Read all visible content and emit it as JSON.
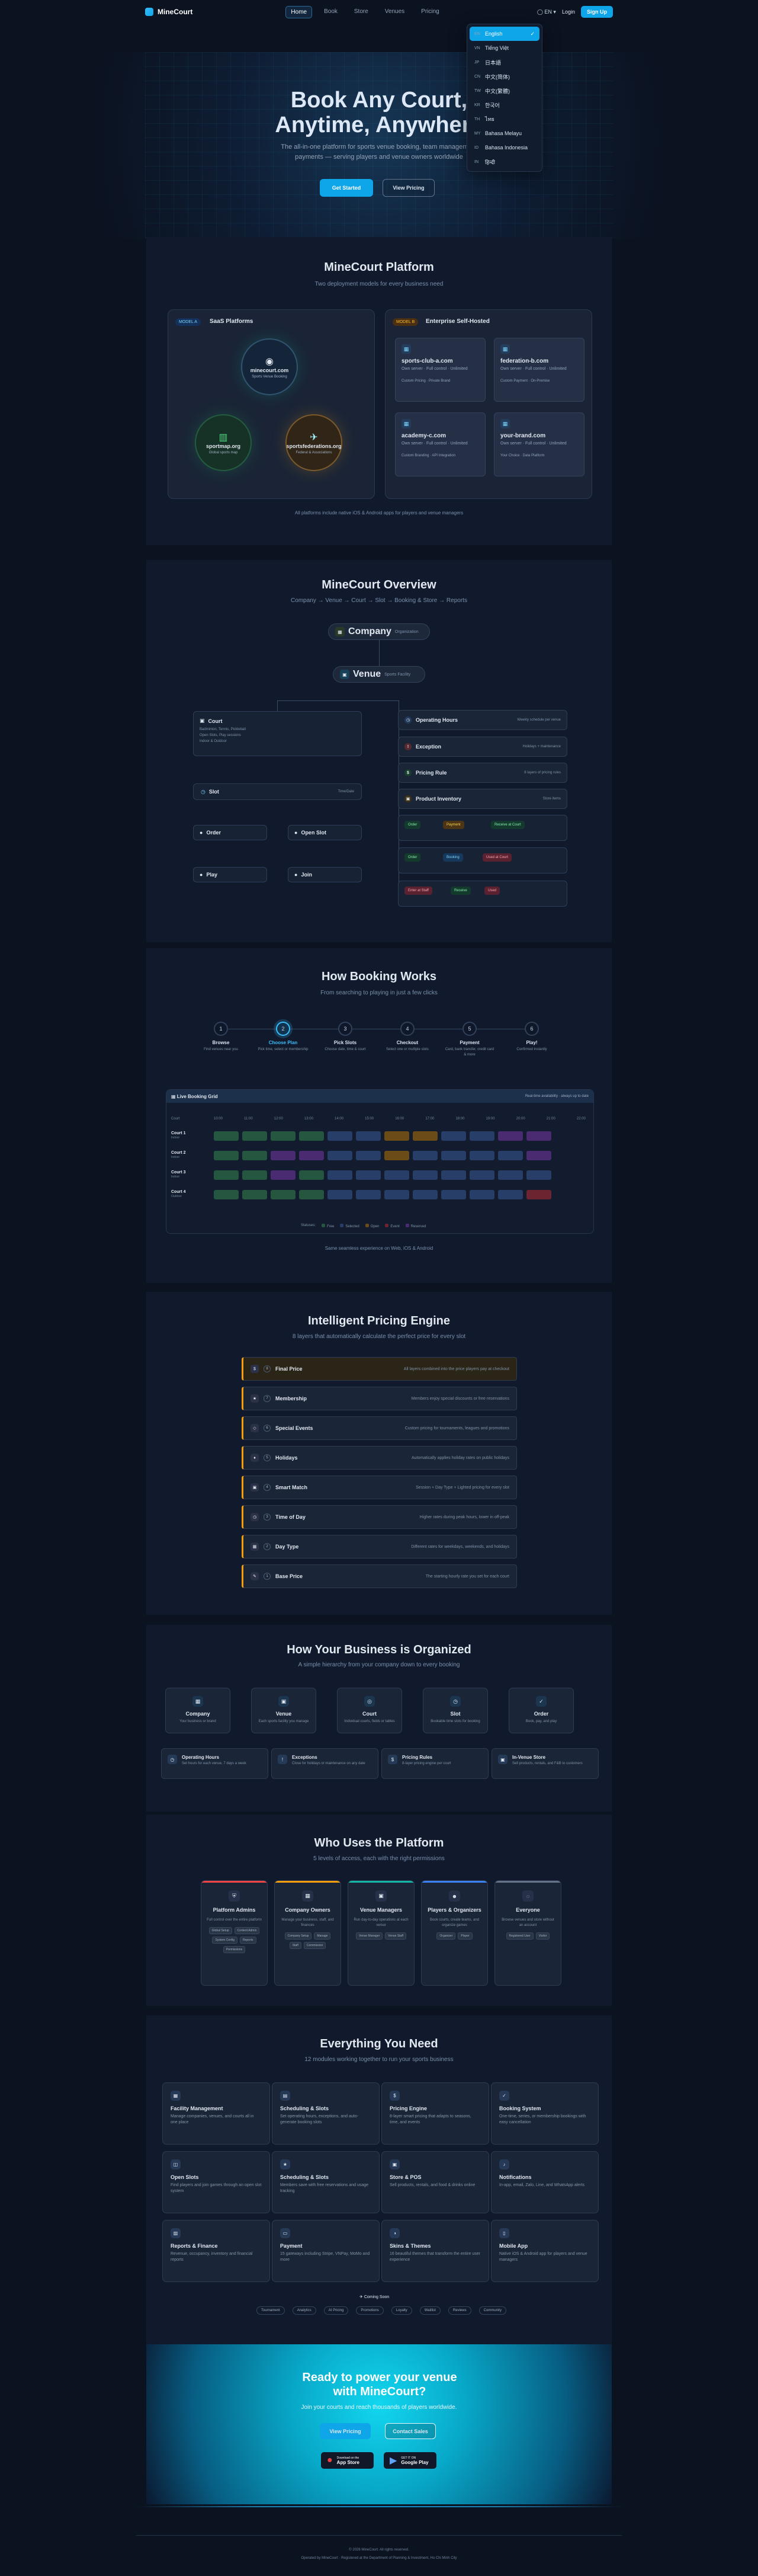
{
  "nav": {
    "brand": "MineCourt",
    "links": [
      "Home",
      "Book",
      "Store",
      "Venues",
      "Pricing"
    ],
    "language": "EN",
    "login": "Login",
    "signup": "Sign Up"
  },
  "languages": [
    {
      "code": "EN",
      "label": "English"
    },
    {
      "code": "VN",
      "label": "Tiếng Việt"
    },
    {
      "code": "JP",
      "label": "日本語"
    },
    {
      "code": "CN",
      "label": "中文(简体)"
    },
    {
      "code": "TW",
      "label": "中文(繁體)"
    },
    {
      "code": "KR",
      "label": "한국어"
    },
    {
      "code": "TH",
      "label": "ไทย"
    },
    {
      "code": "MY",
      "label": "Bahasa Melayu"
    },
    {
      "code": "ID",
      "label": "Bahasa Indonesia"
    },
    {
      "code": "IN",
      "label": "हिन्दी"
    }
  ],
  "hero": {
    "title_line1": "Book Any Court,",
    "title_line2": "Anytime, Anywhere",
    "subtitle_line1": "The all-in-one platform for sports venue booking, team management",
    "subtitle_line2": "payments — serving players and venue owners worldwide",
    "primary": "Get Started",
    "secondary": "View Pricing"
  },
  "platform": {
    "title": "MineCourt Platform",
    "subtitle": "Two deployment models for every business need",
    "saas_tag": "MODEL A",
    "saas_title": "SaaS Platforms",
    "enterprise_tag": "MODEL B",
    "enterprise_title": "Enterprise Self-Hosted",
    "circles": [
      {
        "name": "minecourt.com",
        "desc": "Sports Venue Booking"
      },
      {
        "name": "sportmap.org",
        "desc": "Global sports map"
      },
      {
        "name": "sportsfederations.org",
        "desc": "Federal & Associations"
      }
    ],
    "sites": [
      {
        "name": "sports-club-a.com",
        "desc": "Own server · Full control · Unlimited",
        "foot": "Custom Pricing · Private Brand"
      },
      {
        "name": "federation-b.com",
        "desc": "Own server · Full control · Unlimited",
        "foot": "Custom Payment · On-Premise"
      },
      {
        "name": "academy-c.com",
        "desc": "Own server · Full control · Unlimited",
        "foot": "Custom Branding · API Integration"
      },
      {
        "name": "your-brand.com",
        "desc": "Own server · Full control · Unlimited",
        "foot": "Your Choice · Data Platform"
      }
    ],
    "note": "All platforms include native iOS & Android apps for players and venue managers"
  },
  "overview": {
    "title": "MineCourt Overview",
    "flow": "Company → Venue → Court → Slot → Booking & Store → Reports",
    "company": "Company",
    "company_sub": "Organization",
    "venue": "Venue",
    "venue_sub": "Sports Facility",
    "court": "Court",
    "court_lines": [
      "Badminton, Tennis, Pickleball",
      "Open Slots, Play sessions",
      "Indoor & Outdoor"
    ],
    "slot": "Slot",
    "time_label": "Time/Date",
    "items": [
      "Order",
      "Open Slot",
      "Play",
      "Join"
    ],
    "rules": [
      {
        "name": "Operating Hours",
        "desc": "Weekly schedule per venue"
      },
      {
        "name": "Exception",
        "desc": "Holidays + maintenance"
      },
      {
        "name": "Pricing Rule",
        "desc": "8 layers of pricing rules"
      },
      {
        "name": "Product Inventory",
        "desc": "Store items"
      }
    ],
    "status_row1": [
      "Order",
      "Payment",
      "Receive at Court"
    ],
    "status_row2": [
      "Order",
      "Booking",
      "Used at Court"
    ],
    "status_row3": [
      "Enter at Staff",
      "Receive",
      "Used"
    ]
  },
  "booking": {
    "title": "How Booking Works",
    "subtitle": "From searching to playing in just a few clicks",
    "steps": [
      {
        "n": "1",
        "t": "Browse",
        "d": "Find venues near you"
      },
      {
        "n": "2",
        "t": "Choose Plan",
        "d": "Pick time, select or membership"
      },
      {
        "n": "3",
        "t": "Pick Slots",
        "d": "Choose date, time & court"
      },
      {
        "n": "4",
        "t": "Checkout",
        "d": "Select one or multiple slots"
      },
      {
        "n": "5",
        "t": "Payment",
        "d": "Card, bank transfer, credit card & more"
      },
      {
        "n": "6",
        "t": "Play!",
        "d": "Confirmed instantly"
      }
    ],
    "grid_title": "Live Booking Grid",
    "grid_hint": "Real-time availability · always up to date",
    "court_col": "Court",
    "times": [
      "10:00",
      "11:00",
      "12:00",
      "13:00",
      "14:00",
      "15:00",
      "16:00",
      "17:00",
      "18:00",
      "19:00",
      "20:00",
      "21:00",
      "22:00"
    ],
    "courts": [
      {
        "name": "Court 1",
        "type": "Indoor"
      },
      {
        "name": "Court 2",
        "type": "Indoor"
      },
      {
        "name": "Court 3",
        "type": "Indoor"
      },
      {
        "name": "Court 4",
        "type": "Outdoor"
      }
    ],
    "legend_label": "Statuses:",
    "legend": [
      "Free",
      "Selected",
      "Open",
      "Event",
      "Reserved"
    ],
    "note": "Same seamless experience on Web, iOS & Android"
  },
  "pricing": {
    "title": "Intelligent Pricing Engine",
    "subtitle": "8 layers that automatically calculate the perfect price for every slot",
    "rows": [
      {
        "icon": "$",
        "n": "8",
        "t": "Final Price",
        "d": "All layers combined into the price players pay at checkout"
      },
      {
        "icon": "★",
        "n": "7",
        "t": "Membership",
        "d": "Members enjoy special discounts or free reservations"
      },
      {
        "icon": "◇",
        "n": "6",
        "t": "Special Events",
        "d": "Custom pricing for tournaments, leagues and promotions"
      },
      {
        "icon": "♦",
        "n": "5",
        "t": "Holidays",
        "d": "Automatically applies holiday rates on public holidays"
      },
      {
        "icon": "▣",
        "n": "4",
        "t": "Smart Match",
        "d": "Session + Day Type + Lighted pricing for every slot"
      },
      {
        "icon": "◷",
        "n": "3",
        "t": "Time of Day",
        "d": "Higher rates during peak hours, lower in off-peak"
      },
      {
        "icon": "▦",
        "n": "2",
        "t": "Day Type",
        "d": "Different rates for weekdays, weekends, and holidays"
      },
      {
        "icon": "✎",
        "n": "1",
        "t": "Base Price",
        "d": "The starting hourly rate you set for each court"
      }
    ]
  },
  "organization": {
    "title": "How Your Business is Organized",
    "subtitle": "A simple hierarchy from your company down to every booking",
    "levels": [
      {
        "t": "Company",
        "d": "Your business or brand"
      },
      {
        "t": "Venue",
        "d": "Each sports facility you manage"
      },
      {
        "t": "Court",
        "d": "Individual courts, fields or tables"
      },
      {
        "t": "Slot",
        "d": "Bookable time slots for booking"
      },
      {
        "t": "Order",
        "d": "Book, pay, and play"
      }
    ],
    "rules": [
      {
        "t": "Operating Hours",
        "d": "Set hours for each venue, 7 days a week"
      },
      {
        "t": "Exceptions",
        "d": "Close for holidays or maintenance on any date"
      },
      {
        "t": "Pricing Rules",
        "d": "8-layer pricing engine per court"
      },
      {
        "t": "In-Venue Store",
        "d": "Sell products, rentals, and F&B to customers"
      }
    ]
  },
  "roles": {
    "title": "Who Uses the Platform",
    "subtitle": "5 levels of access, each with the right permissions",
    "cards": [
      {
        "t": "Platform Admins",
        "d": "Full control over the entire platform",
        "chips": [
          "Global Setup",
          "Content Admin",
          "System Config",
          "Reports",
          "Permissions"
        ]
      },
      {
        "t": "Company Owners",
        "d": "Manage your business, staff, and finances",
        "chips": [
          "Company Setup",
          "Manage",
          "Staff",
          "Commission"
        ]
      },
      {
        "t": "Venue Managers",
        "d": "Run day-to-day operations at each venue",
        "chips": [
          "Venue Manager",
          "Venue Staff"
        ]
      },
      {
        "t": "Players & Organizers",
        "d": "Book courts, create teams, and organize games",
        "chips": [
          "Organizer",
          "Player"
        ]
      },
      {
        "t": "Everyone",
        "d": "Browse venues and store without an account",
        "chips": [
          "Registered User",
          "Visitor"
        ]
      }
    ]
  },
  "everything": {
    "title": "Everything You Need",
    "subtitle": "12 modules working together to run your sports business",
    "features": [
      {
        "t": "Facility Management",
        "d": "Manage companies, venues, and courts all in one place"
      },
      {
        "t": "Scheduling & Slots",
        "d": "Set operating hours, exceptions, and auto-generate booking slots"
      },
      {
        "t": "Pricing Engine",
        "d": "8-layer smart pricing that adapts to seasons, time, and events"
      },
      {
        "t": "Booking System",
        "d": "One-time, series, or membership bookings with easy cancellation"
      },
      {
        "t": "Open Slots",
        "d": "Find players and join games through an open slot system"
      },
      {
        "t": "Scheduling & Slots",
        "d": "Members save with free reservations and usage tracking"
      },
      {
        "t": "Store & POS",
        "d": "Sell products, rentals, and food & drinks online"
      },
      {
        "t": "Notifications",
        "d": "In-app, email, Zalo, Line, and WhatsApp alerts"
      },
      {
        "t": "Reports & Finance",
        "d": "Revenue, occupancy, inventory and financial reports"
      },
      {
        "t": "Payment",
        "d": "15 gateways including Stripe, VNPay, MoMo and more"
      },
      {
        "t": "Skins & Themes",
        "d": "16 beautiful themes that transform the entire user experience"
      },
      {
        "t": "Mobile App",
        "d": "Native iOS & Android app for players and venue managers"
      }
    ],
    "coming_soon": "Coming Soon",
    "future": [
      "Tournament",
      "Analytics",
      "AI Pricing",
      "Promotions",
      "Loyalty",
      "Waitlist",
      "Reviews",
      "Community"
    ]
  },
  "cta": {
    "title_line1": "Ready to power your venue",
    "title_line2": "with MineCourt?",
    "subtitle": "Join your courts and reach thousands of players worldwide.",
    "primary": "View Pricing",
    "secondary": "Contact Sales",
    "app_small": "Download on the",
    "app_store": "App Store",
    "play_small": "GET IT ON",
    "play_store": "Google Play"
  },
  "footer": {
    "line1": "© 2026 MineCourt. All rights reserved.",
    "line2": "Operated by MineCourt · Registered at the Department of Planning & Investment, Ho Chi Minh City"
  },
  "colors": {
    "accent": "#0ea5e9",
    "bg": "#0b1220",
    "panel": "#111a2d",
    "amber": "#f59e0b"
  }
}
